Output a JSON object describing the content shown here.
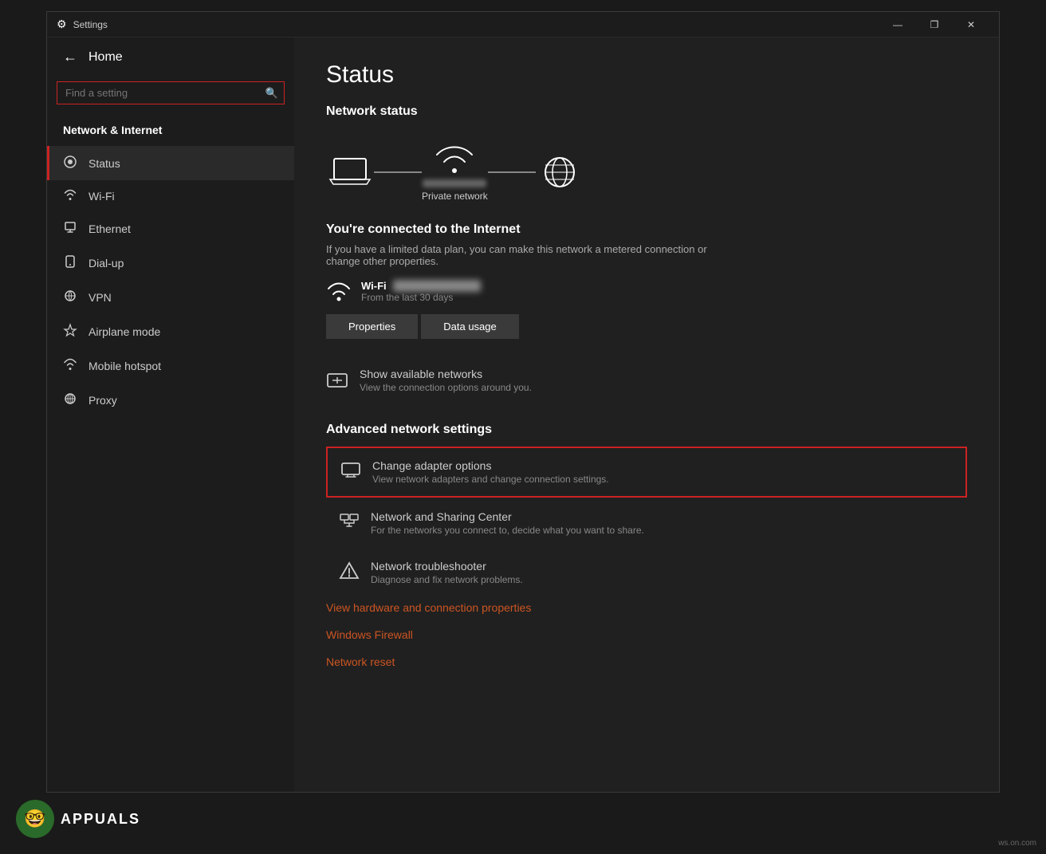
{
  "window": {
    "title": "Settings",
    "titlebar": {
      "minimize_label": "—",
      "maximize_label": "❐",
      "close_label": "✕"
    }
  },
  "sidebar": {
    "home_label": "Home",
    "search_placeholder": "Find a setting",
    "section_label": "Network & Internet",
    "nav_items": [
      {
        "id": "status",
        "label": "Status",
        "active": true
      },
      {
        "id": "wifi",
        "label": "Wi-Fi",
        "active": false
      },
      {
        "id": "ethernet",
        "label": "Ethernet",
        "active": false
      },
      {
        "id": "dialup",
        "label": "Dial-up",
        "active": false
      },
      {
        "id": "vpn",
        "label": "VPN",
        "active": false
      },
      {
        "id": "airplane",
        "label": "Airplane mode",
        "active": false
      },
      {
        "id": "hotspot",
        "label": "Mobile hotspot",
        "active": false
      },
      {
        "id": "proxy",
        "label": "Proxy",
        "active": false
      }
    ]
  },
  "main": {
    "page_title": "Status",
    "network_status_title": "Network status",
    "network_label": "Private network",
    "connected_title": "You're connected to the Internet",
    "connected_desc": "If you have a limited data plan, you can make this network a metered connection or change other properties.",
    "wifi_name": "Wi-Fi",
    "wifi_blurred": "██████████",
    "wifi_sub": "From the last 30 days",
    "properties_btn": "Properties",
    "data_usage_btn": "Data usage",
    "available_networks": {
      "title": "Show available networks",
      "desc": "View the connection options around you."
    },
    "advanced_title": "Advanced network settings",
    "settings_items": [
      {
        "id": "change-adapter",
        "title": "Change adapter options",
        "desc": "View network adapters and change connection settings.",
        "highlighted": true
      },
      {
        "id": "sharing-center",
        "title": "Network and Sharing Center",
        "desc": "For the networks you connect to, decide what you want to share.",
        "highlighted": false
      },
      {
        "id": "troubleshooter",
        "title": "Network troubleshooter",
        "desc": "Diagnose and fix network problems.",
        "highlighted": false
      }
    ],
    "links": [
      "View hardware and connection properties",
      "Windows Firewall",
      "Network reset"
    ]
  },
  "watermark": "ws.on.com"
}
